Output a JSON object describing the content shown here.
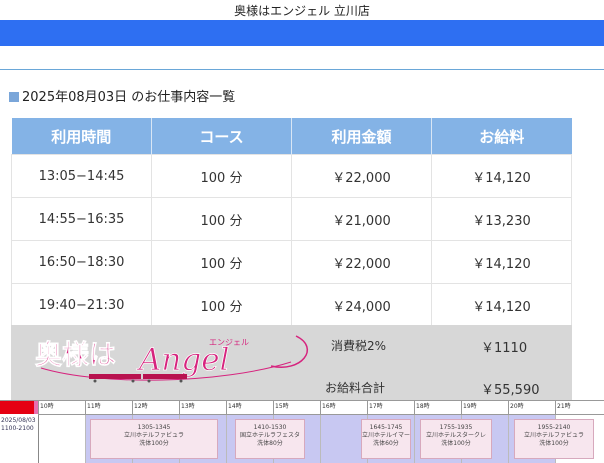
{
  "header": {
    "shop_name": "奥様はエンジェル 立川店"
  },
  "page": {
    "heading": "2025年08月03日 のお仕事内容一覧"
  },
  "table": {
    "columns": [
      "利用時間",
      "コース",
      "利用金額",
      "お給料"
    ],
    "rows": [
      [
        "13:05−14:45",
        "100 分",
        "￥22,000",
        "￥14,120"
      ],
      [
        "14:55−16:35",
        "100 分",
        "￥21,000",
        "￥13,230"
      ],
      [
        "16:50−18:30",
        "100 分",
        "￥22,000",
        "￥14,120"
      ],
      [
        "19:40−21:30",
        "100 分",
        "￥24,000",
        "￥14,120"
      ]
    ]
  },
  "summary": {
    "logo_text": "奥様は",
    "logo_script": "Angel",
    "logo_kana": "エンジェル",
    "tax_label": "消費税2%",
    "tax_value": "￥1110",
    "total_label": "お給料合計",
    "total_value": "￥55,590"
  },
  "timeline": {
    "date": "2025/08/03",
    "shift": "1100-2100",
    "hours": [
      "10時",
      "11時",
      "12時",
      "13時",
      "14時",
      "15時",
      "16時",
      "17時",
      "18時",
      "19時",
      "20時",
      "21時"
    ],
    "bookings": [
      {
        "time": "1305-1345",
        "place": "立川ホテルファビュラ",
        "course": "洗体100分"
      },
      {
        "time": "1410-1530",
        "place": "国立ホテルラフェスタ",
        "course": "洗体80分"
      },
      {
        "time": "1645-1745",
        "place": "立川ホテルイマー",
        "course": "洗体60分"
      },
      {
        "time": "1755-1935",
        "place": "立川ホテルスタークレ",
        "course": "洗体100分"
      },
      {
        "time": "1955-2140",
        "place": "立川ホテルファビュラ",
        "course": "洗体100分"
      }
    ]
  },
  "colors": {
    "header_bar": "#2e6ff2",
    "table_head": "#84b3e6",
    "summary_bg": "#d7d7d7",
    "logo_pink": "#d6247e"
  }
}
